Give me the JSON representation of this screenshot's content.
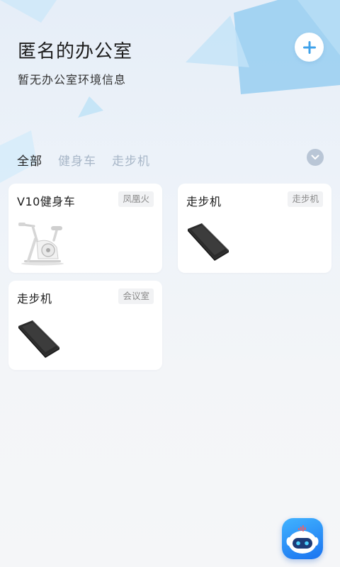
{
  "header": {
    "title": "匿名的办公室",
    "subtitle": "暂无办公室环境信息"
  },
  "tabs": [
    {
      "label": "全部",
      "active": true
    },
    {
      "label": "健身车",
      "active": false
    },
    {
      "label": "走步机",
      "active": false
    }
  ],
  "devices": [
    {
      "name": "V10健身车",
      "tag": "凤凰火",
      "image": "exercise-bike"
    },
    {
      "name": "走步机",
      "tag": "走步机",
      "image": "treadmill"
    },
    {
      "name": "走步机",
      "tag": "会议室",
      "image": "treadmill"
    }
  ],
  "icons": {
    "add": "plus-icon",
    "expand": "chevron-down-icon",
    "assistant": "robot-assistant-icon"
  },
  "colors": {
    "tab_inactive": "#a8b7c8",
    "accent_blue": "#3fa2ea",
    "card_background": "#ffffff",
    "tag_background": "#f1f2f4"
  }
}
